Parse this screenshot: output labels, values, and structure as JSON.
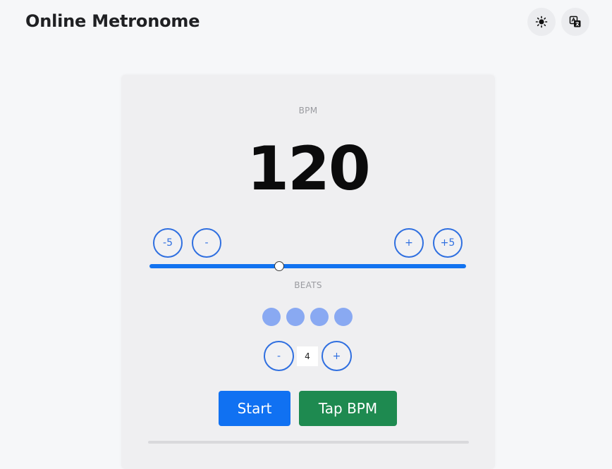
{
  "header": {
    "title": "Online Metronome",
    "theme_icon": "sun-icon",
    "language_icon": "translate-icon"
  },
  "bpm": {
    "label": "BPM",
    "value": "120",
    "minus5_label": "-5",
    "minus_label": "-",
    "plus_label": "+",
    "plus5_label": "+5",
    "slider_fraction": 0.41
  },
  "beats": {
    "label": "BEATS",
    "count": "4",
    "minus_label": "-",
    "plus_label": "+"
  },
  "actions": {
    "start_label": "Start",
    "tap_label": "Tap BPM"
  },
  "colors": {
    "accent_blue": "#1071f2",
    "tap_green": "#1e8a50",
    "beat_dot": "#89a9f2"
  }
}
